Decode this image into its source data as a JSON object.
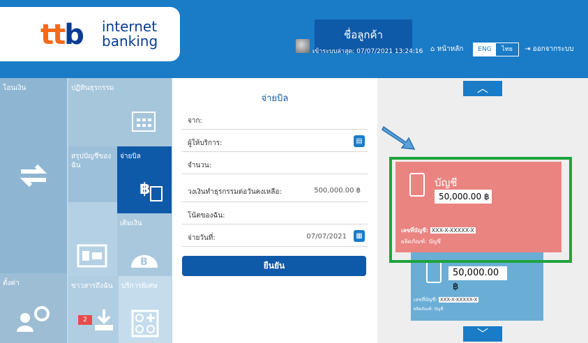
{
  "header": {
    "logo_mark": "ttb",
    "logo_line1": "internet",
    "logo_line2": "banking",
    "customer_name": "ชื่อลูกค้า",
    "last_login": "เข้าระบบล่าสุด: 07/07/2021 13:24:16",
    "home_label": "หน้าหลัก",
    "lang_eng": "ENG",
    "lang_thai": "ไทย",
    "logout_label": "ออกจากระบบ"
  },
  "tiles": {
    "transfer": "โอนเงิน",
    "pay_label": "ปฏิทินธุรกรรม",
    "summary": "สรุปบัญชีของฉัน",
    "billpay": "จ่ายบิล",
    "topup": "เติมเงิน",
    "settings": "ตั้งค่า",
    "news": "ข่าวสารถึงฉัน",
    "other": "บริการพิเศษ",
    "badge": "2"
  },
  "form": {
    "title": "จ่ายบิล",
    "from_label": "จาก:",
    "biller_label": "ผู้ให้บริการ:",
    "amount_label": "จำนวน:",
    "limit_label": "วงเงินทำธุรกรรมต่อวันคงเหลือ:",
    "limit_value": "500,000.00 ฿",
    "memo_label": "โน้ตของฉัน:",
    "date_label": "จ่ายวันที่:",
    "date_value": "07/07/2021",
    "confirm_label": "ยืนยัน"
  },
  "cards": {
    "front": {
      "title": "บัญชี",
      "amount": "50,000.00 ฿",
      "acc_label": "เลขที่บัญชี:",
      "acc_no": "XXX-X-XXXXX-X",
      "prod_label": "ผลิตภัณฑ์:",
      "prod_value": "บัญชี"
    },
    "back": {
      "amount": "50,000.00 ฿",
      "acc_label": "เลขที่บัญชี:",
      "acc_no": "XXX-X-XXXXX-X",
      "prod_label": "ผลิตภัณฑ์:",
      "prod_value": "บัญชี"
    }
  },
  "nav": {
    "up_icon": "chevron-up-icon",
    "down_icon": "chevron-down-icon"
  },
  "colors": {
    "brand_blue": "#1a7bc7",
    "dark_blue": "#0f5aa8",
    "card_red": "#ea8481",
    "card_blue": "#6aaed6",
    "highlight_green": "#1ea33c"
  }
}
